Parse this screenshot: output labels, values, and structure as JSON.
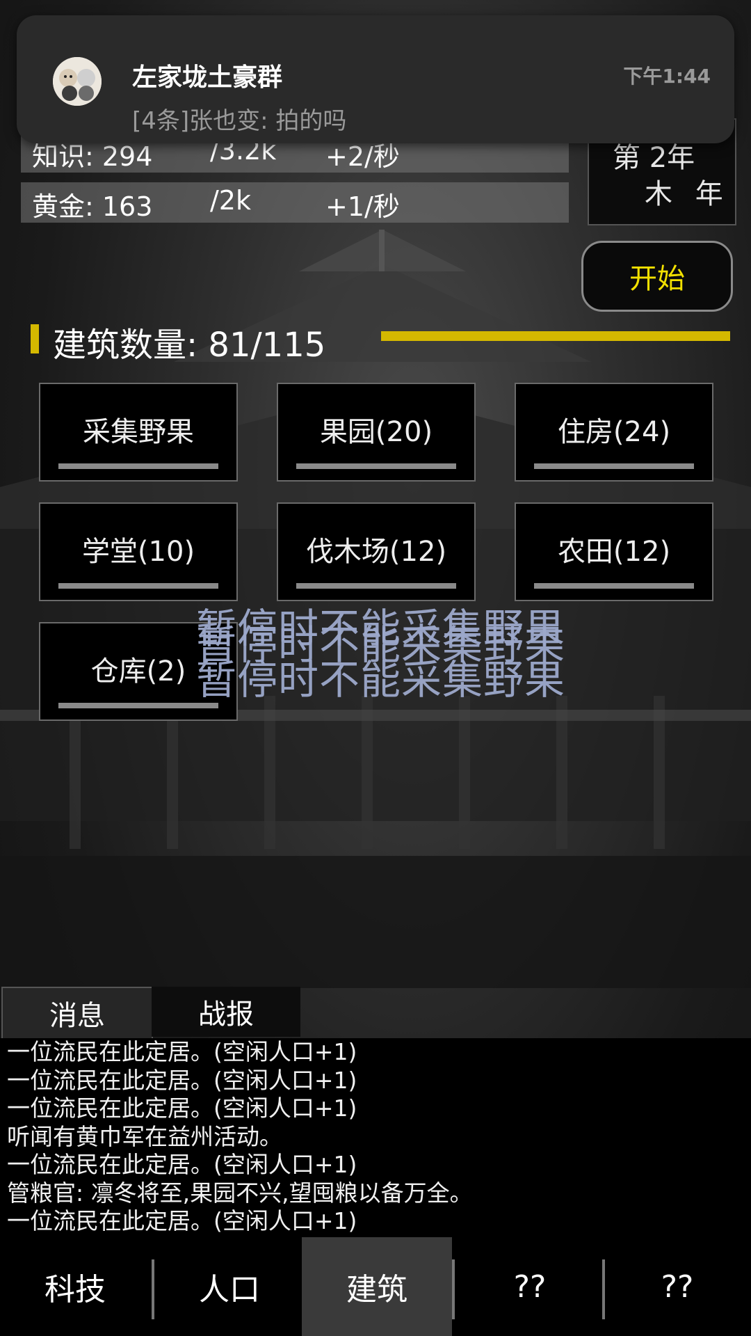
{
  "notification": {
    "title": "左家垅土豪群",
    "message": "[4条]张也变: 拍的吗",
    "time": "下午1:44"
  },
  "resources": [
    {
      "name": "知识: 294",
      "max": "/3.2k",
      "rate": "+2/秒"
    },
    {
      "name": "黄金: 163",
      "max": "/2k",
      "rate": "+1/秒"
    }
  ],
  "calendar": {
    "line1": "第 2年",
    "line2": "木 年"
  },
  "start_button": "开始",
  "buildings_section": {
    "title": "建筑数量: 81/115"
  },
  "buildings": [
    {
      "label": "采集野果"
    },
    {
      "label": "果园(20)"
    },
    {
      "label": "住房(24)"
    },
    {
      "label": "学堂(10)"
    },
    {
      "label": "伐木场(12)"
    },
    {
      "label": "农田(12)"
    },
    {
      "label": "仓库(2)"
    }
  ],
  "floating_messages": [
    "暂停时不能采集野果",
    "暂停时不能采集野果",
    "暂停时不能采集野果"
  ],
  "log_tabs": {
    "messages": "消息",
    "battle": "战报"
  },
  "log_lines": [
    "一位流民在此定居。(空闲人口+1)",
    "一位流民在此定居。(空闲人口+1)",
    "一位流民在此定居。(空闲人口+1)",
    "听闻有黄巾军在益州活动。",
    "一位流民在此定居。(空闲人口+1)",
    "管粮官: 凛冬将至,果园不兴,望囤粮以备万全。",
    "一位流民在此定居。(空闲人口+1)"
  ],
  "nav": [
    {
      "label": "科技",
      "active": false
    },
    {
      "label": "人口",
      "active": false
    },
    {
      "label": "建筑",
      "active": true
    },
    {
      "label": "??",
      "active": false
    },
    {
      "label": "??",
      "active": false
    }
  ],
  "colors": {
    "accent": "#d4b800",
    "start_text": "#f2e000",
    "floating_text": "#9da9cc"
  }
}
